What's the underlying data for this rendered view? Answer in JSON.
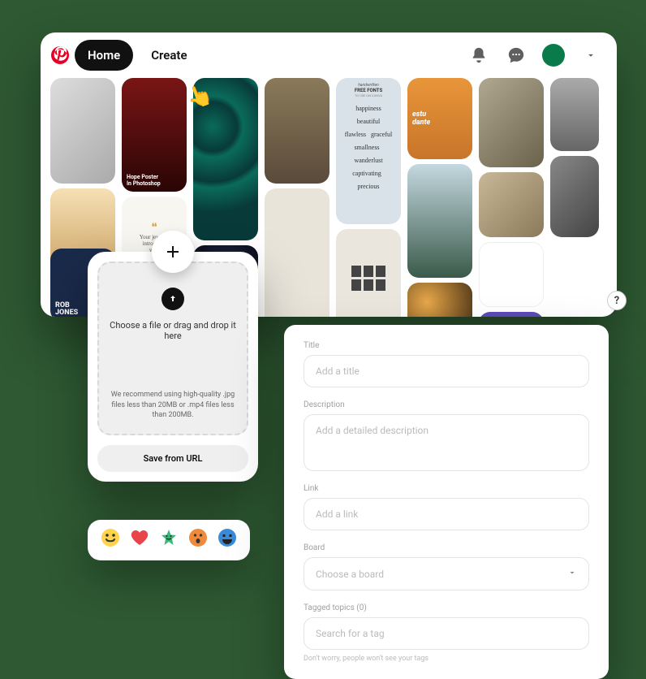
{
  "nav": {
    "home": "Home",
    "create": "Create"
  },
  "upload": {
    "drop_text": "Choose a file or drag and drop it here",
    "recommend": "We recommend using high-quality .jpg files less than 20MB or .mp4 files less than 200MB.",
    "url_button": "Save from URL"
  },
  "form": {
    "title_label": "Title",
    "title_placeholder": "Add a title",
    "desc_label": "Description",
    "desc_placeholder": "Add a detailed description",
    "link_label": "Link",
    "link_placeholder": "Add a link",
    "board_label": "Board",
    "board_placeholder": "Choose a board",
    "tags_label": "Tagged topics (0)",
    "tags_placeholder": "Search for a tag",
    "tags_fine": "Don't worry, people won't see your tags"
  },
  "pins": [
    {
      "title": "Hope Poster In Photoshop"
    },
    {
      "title": "ROB JONES"
    },
    {
      "title": "Your jewelry introduces you."
    },
    {
      "title": "FREE FONTS"
    },
    {
      "title": "estudante"
    }
  ],
  "reactions": [
    "😄",
    "❤️",
    "⭐",
    "😮",
    "😃"
  ],
  "help": "?"
}
